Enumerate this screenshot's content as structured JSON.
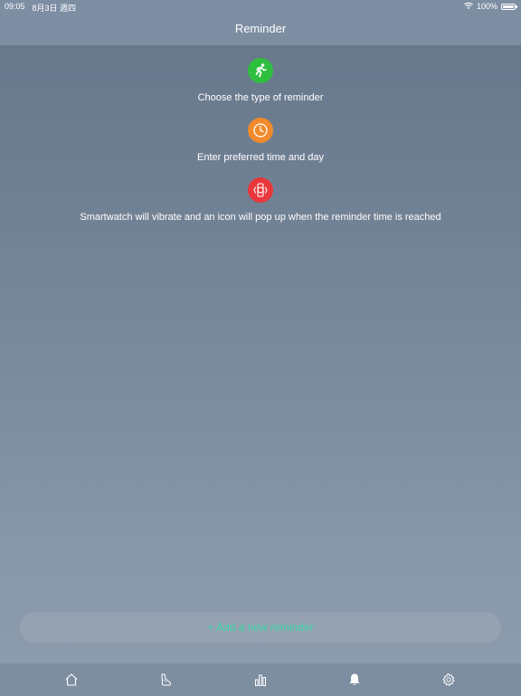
{
  "status_bar": {
    "time": "09:05",
    "date": "8月3日 週四",
    "battery": "100%",
    "icons": [
      "wifi-icon",
      "battery-icon"
    ]
  },
  "header": {
    "title": "Reminder"
  },
  "steps": [
    {
      "icon": "running-icon",
      "color": "#2fbf3f",
      "text": "Choose the type of reminder"
    },
    {
      "icon": "clock-icon",
      "color": "#f08a2c",
      "text": "Enter preferred time and day"
    },
    {
      "icon": "vibrating-watch-icon",
      "color": "#e8383c",
      "text": "Smartwatch will vibrate and an icon will pop up when the reminder time is reached"
    }
  ],
  "add_button": {
    "label": "+ Add a new reminder",
    "color": "#3fd8a7"
  },
  "tab_bar": {
    "items": [
      {
        "icon": "home-icon"
      },
      {
        "icon": "shoe-icon"
      },
      {
        "icon": "bar-chart-icon"
      },
      {
        "icon": "bell-icon",
        "active": true
      },
      {
        "icon": "gear-icon"
      }
    ]
  }
}
